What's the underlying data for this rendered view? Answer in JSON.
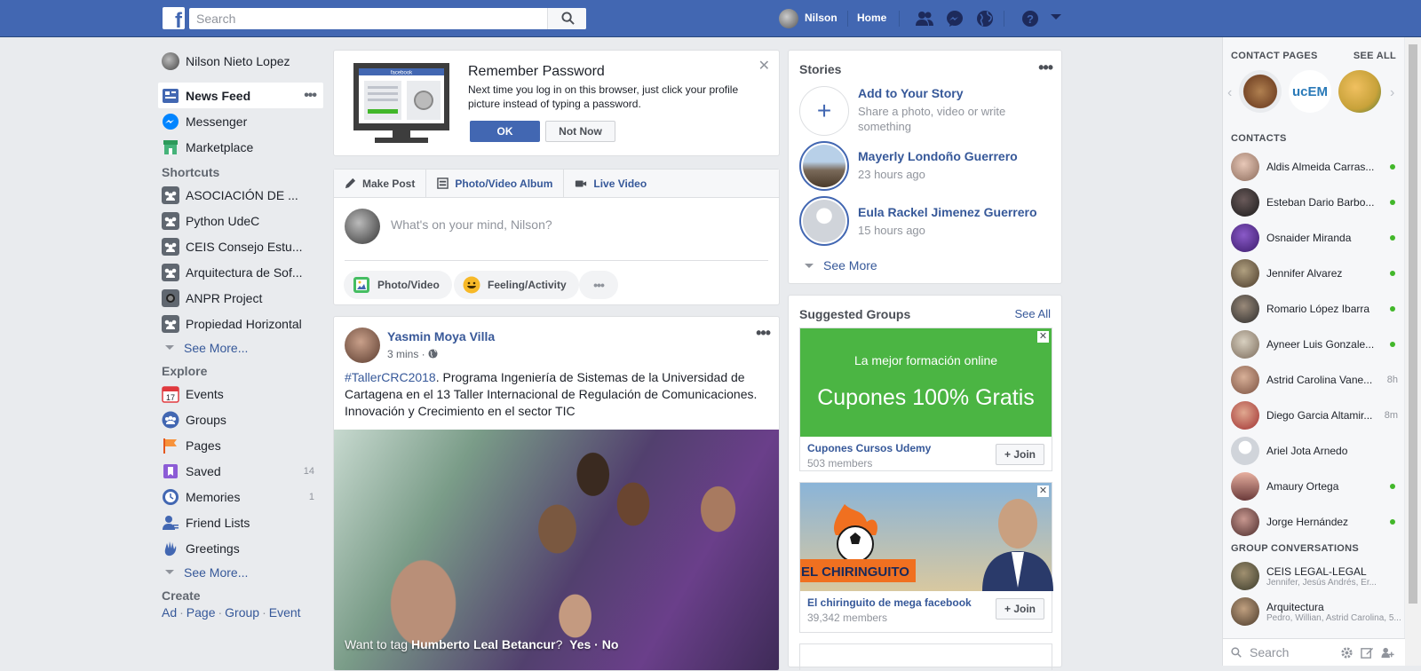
{
  "topbar": {
    "search_placeholder": "Search",
    "user_name": "Nilson",
    "home_label": "Home"
  },
  "left_nav": {
    "profile_name": "Nilson Nieto Lopez",
    "main": [
      {
        "label": "News Feed",
        "icon": "news-feed-icon"
      },
      {
        "label": "Messenger",
        "icon": "messenger-icon"
      },
      {
        "label": "Marketplace",
        "icon": "marketplace-icon"
      }
    ],
    "shortcuts_heading": "Shortcuts",
    "shortcuts": [
      {
        "label": "ASOCIACIÓN DE ..."
      },
      {
        "label": "Python UdeC"
      },
      {
        "label": "CEIS Consejo Estu..."
      },
      {
        "label": "Arquitectura de Sof..."
      },
      {
        "label": "ANPR Project"
      },
      {
        "label": "Propiedad Horizontal"
      }
    ],
    "see_more": "See More...",
    "explore_heading": "Explore",
    "explore": [
      {
        "label": "Events",
        "count": ""
      },
      {
        "label": "Groups",
        "count": ""
      },
      {
        "label": "Pages",
        "count": ""
      },
      {
        "label": "Saved",
        "count": "14"
      },
      {
        "label": "Memories",
        "count": "1"
      },
      {
        "label": "Friend Lists",
        "count": ""
      },
      {
        "label": "Greetings",
        "count": ""
      }
    ],
    "create_heading": "Create",
    "create_links": [
      "Ad",
      "Page",
      "Group",
      "Event"
    ]
  },
  "remember_password": {
    "title": "Remember Password",
    "text": "Next time you log in on this browser, just click your profile picture instead of typing a password.",
    "ok_label": "OK",
    "not_now_label": "Not Now",
    "illustration_label": "facebook"
  },
  "composer": {
    "tabs": [
      "Make Post",
      "Photo/Video Album",
      "Live Video"
    ],
    "placeholder": "What's on your mind, Nilson?",
    "actions": [
      "Photo/Video",
      "Feeling/Activity"
    ]
  },
  "post": {
    "author": "Yasmin Moya Villa",
    "time": "3 mins",
    "hashtag": "#TallerCRC2018",
    "text": ". Programa Ingeniería de Sistemas de la Universidad de Cartagena en el 13 Taller Internacional de Regulación de Comunicaciones. Innovación y Crecimiento en el sector TIC",
    "tag_prompt": "Want to tag",
    "tag_person": "Humberto Leal Betancur",
    "tag_suffix": "?",
    "tag_actions": "Yes · No"
  },
  "stories": {
    "heading": "Stories",
    "add_title": "Add to Your Story",
    "add_sub": "Share a photo, video or write something",
    "items": [
      {
        "name": "Mayerly Londoño Guerrero",
        "time": "23 hours ago"
      },
      {
        "name": "Eula Rackel Jimenez Guerrero",
        "time": "15 hours ago"
      }
    ],
    "see_more": "See More"
  },
  "suggested_groups": {
    "heading": "Suggested Groups",
    "see_all": "See All",
    "groups": [
      {
        "name": "Cupones Cursos Udemy",
        "members": "503 members",
        "banner_line1": "La mejor formación online",
        "banner_line2": "Cupones 100% Gratis",
        "join": "Join"
      },
      {
        "name": "El chiringuito de mega facebook",
        "members": "39,342 members",
        "banner_line1": "EL CHIRINGUITO",
        "join": "Join"
      }
    ]
  },
  "chat": {
    "contact_pages_heading": "CONTACT PAGES",
    "see_all": "SEE ALL",
    "contact_pages": [
      {
        "label": "",
        "color": "#7a4a2a"
      },
      {
        "label": "ucEM",
        "color": "#2a7ab8"
      },
      {
        "label": "",
        "color": "#c8a23a"
      }
    ],
    "contacts_heading": "CONTACTS",
    "contacts": [
      {
        "name": "Aldis Almeida Carras...",
        "status": "online"
      },
      {
        "name": "Esteban Dario Barbo...",
        "status": "online"
      },
      {
        "name": "Osnaider Miranda",
        "status": "online"
      },
      {
        "name": "Jennifer Alvarez",
        "status": "online"
      },
      {
        "name": "Romario López Ibarra",
        "status": "online"
      },
      {
        "name": "Ayneer Luis Gonzale...",
        "status": "online"
      },
      {
        "name": "Astrid Carolina Vane...",
        "status": "8h"
      },
      {
        "name": "Diego Garcia Altamir...",
        "status": "8m"
      },
      {
        "name": "Ariel Jota Arnedo",
        "status": ""
      },
      {
        "name": "Amaury Ortega",
        "status": "online"
      },
      {
        "name": "Jorge Hernández",
        "status": "online"
      }
    ],
    "group_conv_heading": "GROUP CONVERSATIONS",
    "group_convs": [
      {
        "name": "CEIS LEGAL-LEGAL",
        "members": "Jennifer, Jesús Andrés, Er..."
      },
      {
        "name": "Arquitectura",
        "members": "Pedro, Willian, Astrid Carolina, 5..."
      }
    ],
    "search_placeholder": "Search"
  }
}
